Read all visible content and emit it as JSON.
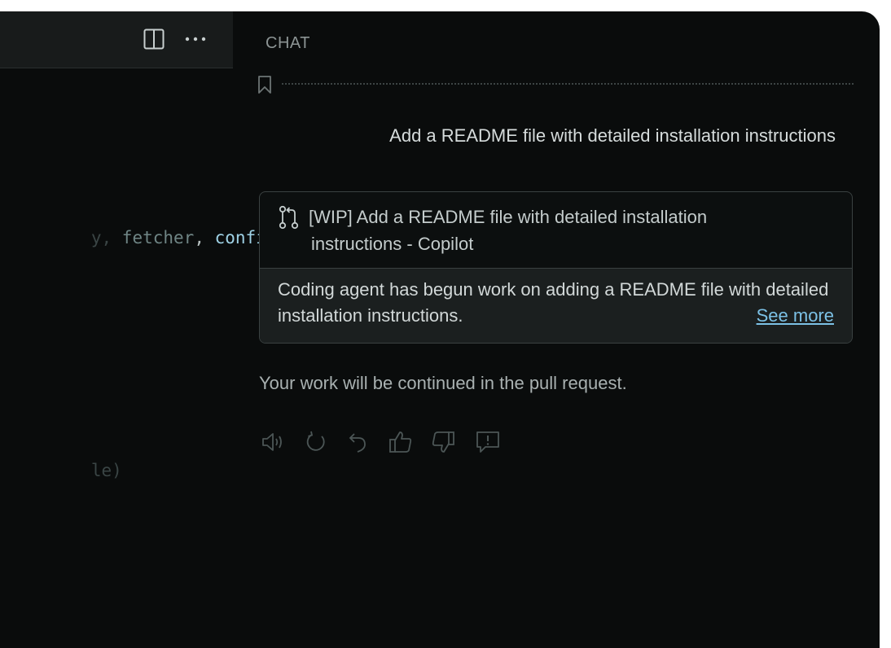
{
  "editor": {
    "toolbar": {
      "icons": [
        "split-editor-icon",
        "more-actions-icon"
      ]
    },
    "code": {
      "line1": {
        "faded": "y, ",
        "mid": "fetcher",
        "punct": ", ",
        "bright": "confi"
      },
      "line2": {
        "faded": "le)"
      }
    }
  },
  "chat": {
    "title": "CHAT",
    "user_message": "Add a README file with detailed installation instructions",
    "card": {
      "title_line1": "[WIP] Add a README file with detailed installation",
      "title_line2": "instructions - Copilot",
      "description": "Coding agent has begun work on adding a README file with detailed installation instructions.",
      "see_more": "See more"
    },
    "response": "Your work will be continued in the pull request.",
    "actions": [
      "read-aloud-icon",
      "retry-icon",
      "undo-icon",
      "thumbs-up-icon",
      "thumbs-down-icon",
      "report-icon"
    ]
  },
  "colors": {
    "background": "#0a0c0c",
    "card_body": "#1b1f1f",
    "link": "#7cc1e6"
  }
}
